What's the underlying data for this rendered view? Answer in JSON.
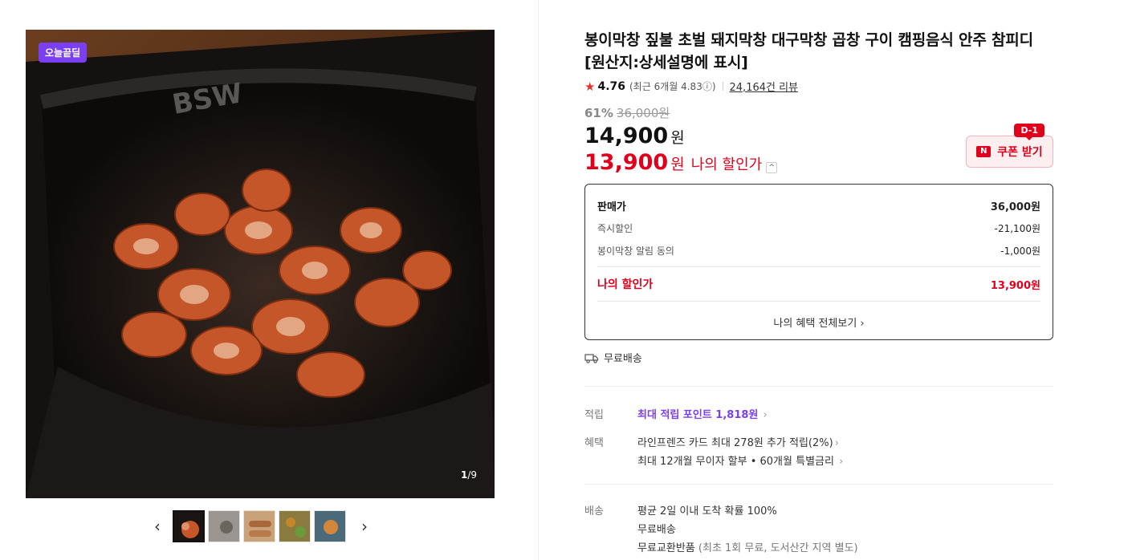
{
  "gallery": {
    "badge": "오늘끝딜",
    "counter_current": "1",
    "counter_total": "/9",
    "prev_arrow": "‹",
    "next_arrow": "›"
  },
  "product": {
    "title": "봉이막창 짚불 초벌 돼지막창 대구막창 곱창 구이 캠핑음식 안주 참피디 [원산지:상세설명에 표시]",
    "rating": "4.76",
    "recent_rating": "(최근 6개월 4.83ⓘ)",
    "reviews": "24,164건 리뷰"
  },
  "price": {
    "discount_pct": "61%",
    "original": "36,000원",
    "current": "14,900",
    "won": "원",
    "my_price": "13,900",
    "my_price_label": "나의 할인가",
    "caret": "^"
  },
  "coupon": {
    "dday": "D-1",
    "n_mark": "N",
    "label": "쿠폰 받기"
  },
  "breakdown": {
    "rows": [
      {
        "label": "판매가",
        "value": "36,000원"
      },
      {
        "label": "즉시할인",
        "value": "-21,100원"
      },
      {
        "label": "봉이막창 알림 동의",
        "value": "-1,000원"
      }
    ],
    "mine_label": "나의 할인가",
    "mine_value": "13,900원",
    "footer": "나의 혜택 전체보기 ›"
  },
  "shipping": {
    "label": "무료배송"
  },
  "specs": {
    "points_key": "적립",
    "points_value": "최대 적립 포인트 1,818원",
    "benefit_key": "혜택",
    "benefit_1": "라인프렌즈 카드 최대 278원 추가 적립(2%)",
    "benefit_2": "최대 12개월 무이자 할부 • 60개월 특별금리",
    "delivery_key": "배송",
    "delivery_1": "평균 2일 이내 도착 확률 100%",
    "delivery_2": "무료배송",
    "delivery_3": "무료교환반품",
    "delivery_3_note": "(최초 1회 무료, 도서산간 지역 별도)"
  },
  "colors": {
    "accent_red": "#e0001b",
    "badge_purple": "#7b3ff2"
  }
}
